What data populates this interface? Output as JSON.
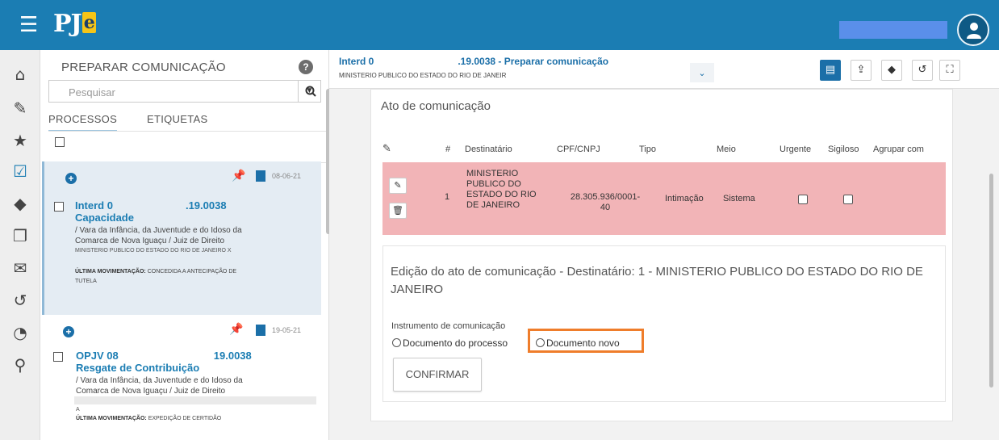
{
  "topbar": {
    "logo_main": "PJ",
    "logo_e": "e"
  },
  "panel": {
    "title": "PREPARAR COMUNICAÇÃO",
    "help": "?",
    "search_placeholder": "Pesquisar",
    "tabs": [
      "PROCESSOS",
      "ETIQUETAS"
    ]
  },
  "cards": [
    {
      "date": "08-06-21",
      "number_a": "Interd 0",
      "number_b": ".19.0038",
      "class": "Capacidade",
      "desc1": "/ Vara da Infância, da Juventude e do Idoso da",
      "desc2": "Comarca de Nova Iguaçu / Juiz de Direito",
      "desc3": "MINISTERIO PUBLICO DO ESTADO DO RIO DE JANEIRO X",
      "mov_label": "ÚLTIMA MOVIMENTAÇÃO:",
      "mov_value": "CONCEDIDA A ANTECIPAÇÃO DE",
      "mov_value2": "TUTELA"
    },
    {
      "date": "19-05-21",
      "number_a": "OPJV 08",
      "number_b": "19.0038",
      "class": "Resgate de Contribuição",
      "desc1": "/ Vara da Infância, da Juventude e do Idoso da",
      "desc2": "Comarca de Nova Iguaçu / Juiz de Direito",
      "desc3": "A",
      "mov_label": "ÚLTIMA MOVIMENTAÇÃO:",
      "mov_value": "EXPEDIÇÃO DE CERTIDÃO"
    }
  ],
  "header": {
    "title_a": "Interd 0",
    "title_b": ".19.0038 - Preparar comunicação",
    "subtitle": "MINISTERIO PUBLICO DO ESTADO DO RIO DE JANEIR"
  },
  "main": {
    "section_title": "Ato de comunicação",
    "columns": [
      "#",
      "Destinatário",
      "CPF/CNPJ",
      "Tipo",
      "Meio",
      "Urgente",
      "Sigiloso",
      "Agrupar com"
    ],
    "row": {
      "num": "1",
      "dest_lines": [
        "MINISTERIO",
        "PUBLICO DO",
        "ESTADO DO RIO",
        "DE JANEIRO"
      ],
      "cpf_lines": [
        "28.305.936/0001-",
        "40"
      ],
      "tipo": "Intimação",
      "meio": "Sistema"
    },
    "edit_title": "Edição do ato de comunicação - Destinatário: 1 - MINISTERIO PUBLICO DO ESTADO DO RIO DE JANEIRO",
    "instrument_label": "Instrumento de comunicação",
    "radio1": "Documento do processo",
    "radio2": "Documento novo",
    "confirm": "CONFIRMAR"
  }
}
